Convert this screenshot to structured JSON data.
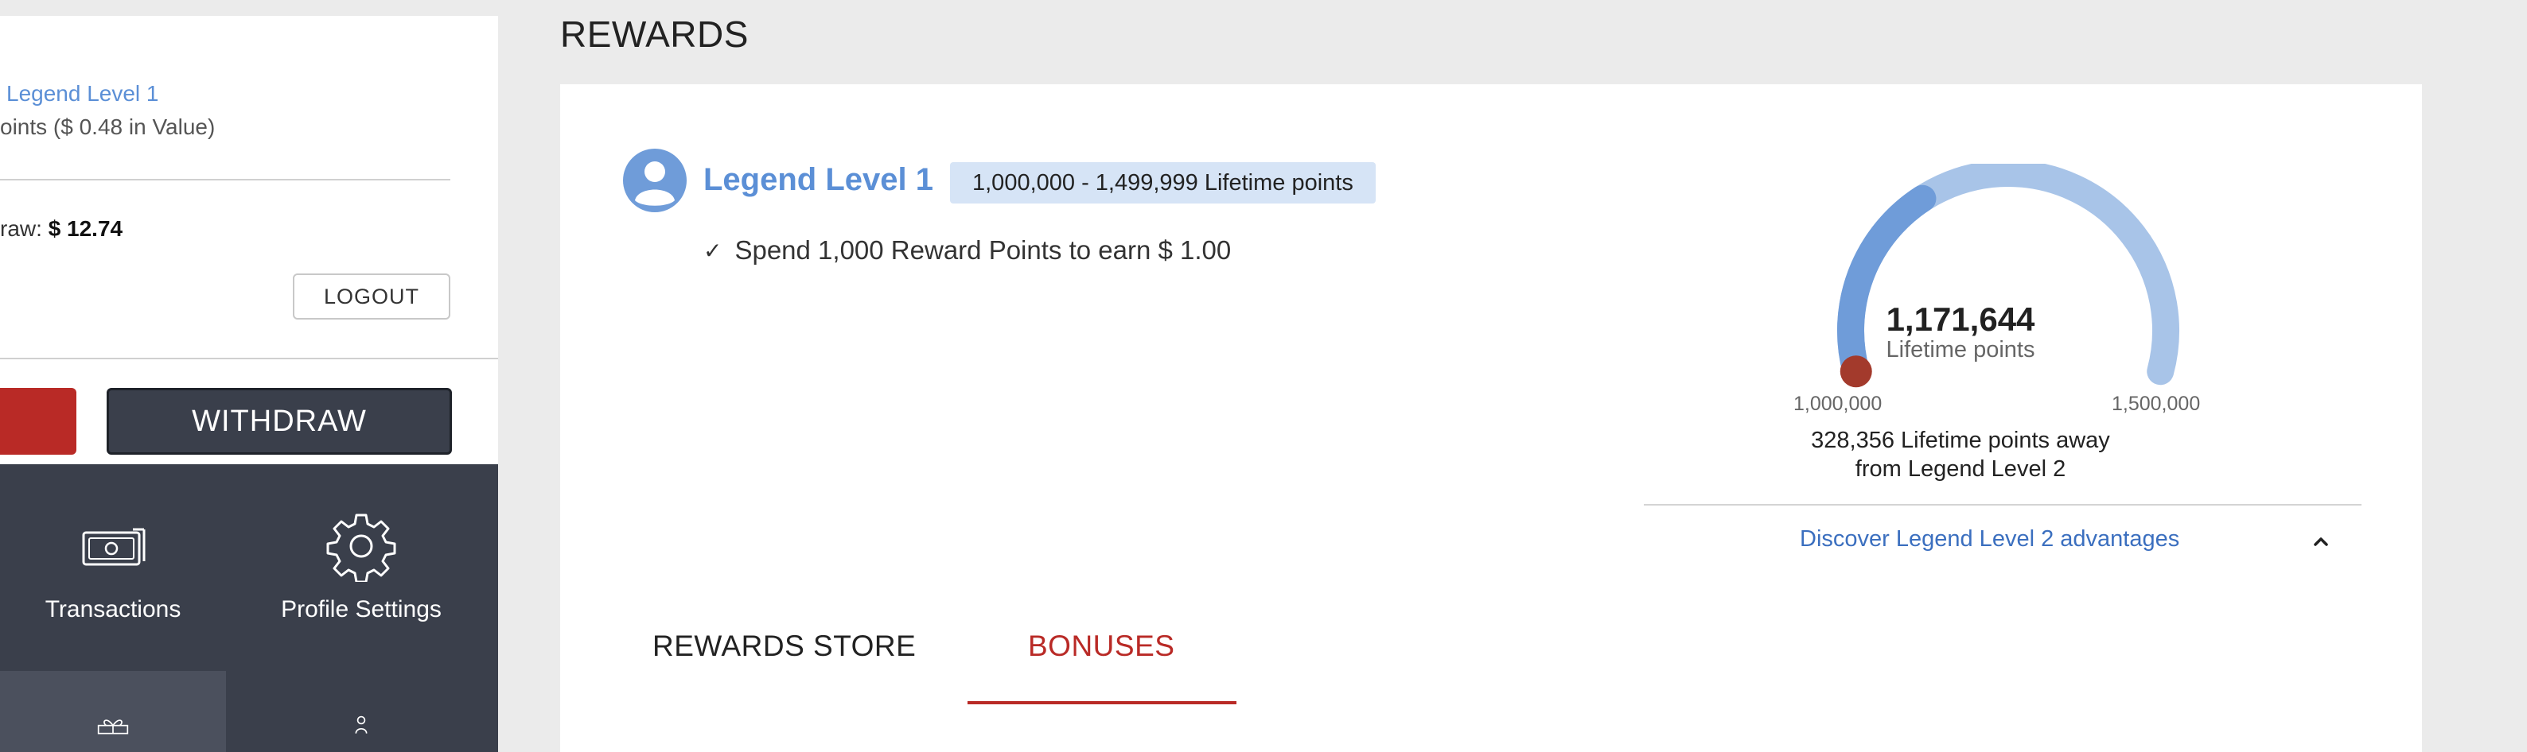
{
  "sidebar": {
    "level_link": "Legend Level 1",
    "points_value": "oints ($ 0.48 in Value)",
    "withdraw_label": "raw: ",
    "withdraw_amount": "$ 12.74",
    "logout_label": "LOGOUT",
    "withdraw_button_label": "WITHDRAW",
    "nav": [
      {
        "label": "Transactions",
        "icon": "money-icon"
      },
      {
        "label": "Profile Settings",
        "icon": "gear-icon"
      },
      {
        "label": "",
        "icon": "gift-icon"
      },
      {
        "label": "",
        "icon": "person-icon"
      }
    ]
  },
  "page": {
    "title": "REWARDS"
  },
  "rewards": {
    "level_title": "Legend Level 1",
    "level_range": "1,000,000 - 1,499,999 Lifetime points",
    "benefit": "Spend 1,000 Reward Points to earn $ 1.00",
    "gauge": {
      "value_text": "1,171,644",
      "caption": "Lifetime points",
      "min_label": "1,000,000",
      "max_label": "1,500,000",
      "value": 1171644,
      "min": 1000000,
      "max": 1500000
    },
    "away_text": "328,356 Lifetime points away from Legend Level 2",
    "discover_link": "Discover Legend Level 2 advantages"
  },
  "tabs": [
    {
      "label": "REWARDS STORE",
      "active": false
    },
    {
      "label": "BONUSES",
      "active": true
    }
  ],
  "colors": {
    "accent_red": "#b92a26",
    "accent_blue": "#5b8fd6",
    "gauge_track": "#a8c4e8",
    "gauge_fill": "#6f9cd9",
    "gauge_marker": "#a33a2c",
    "nav_bg": "#3a3f4b"
  }
}
